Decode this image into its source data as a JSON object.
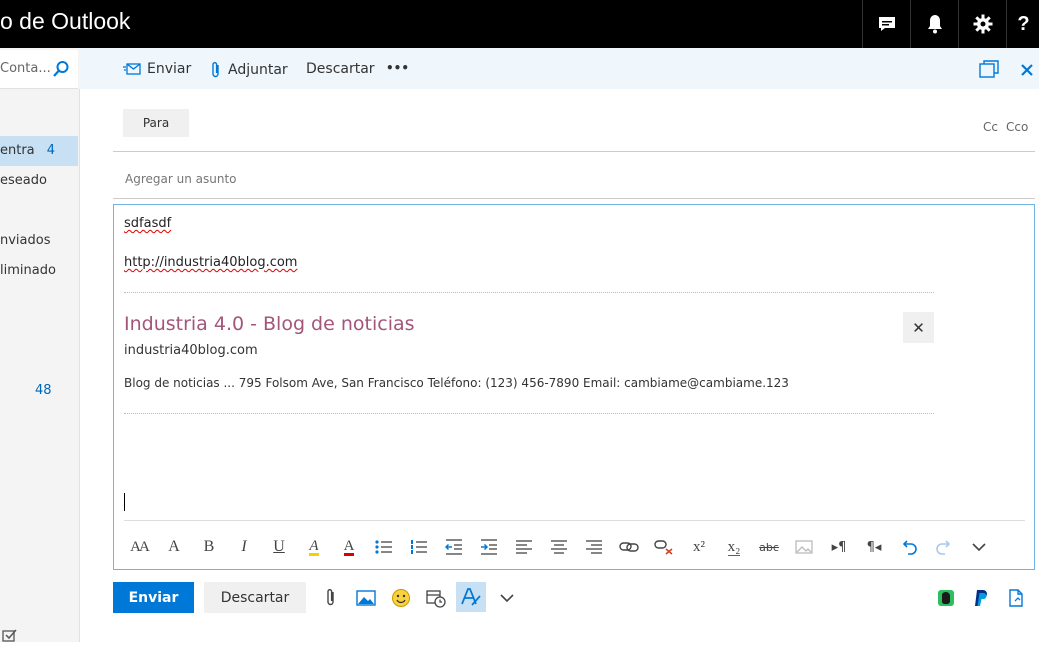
{
  "window": {
    "title": "o de Outlook"
  },
  "search": {
    "placeholder": "Conta..."
  },
  "nav": {
    "items": [
      {
        "label": "entra",
        "count": "4"
      },
      {
        "label": "eseado"
      },
      {
        "label": "nviados"
      },
      {
        "label": "liminado"
      }
    ],
    "extra_count": "48"
  },
  "toolbar": {
    "send": "Enviar",
    "attach": "Adjuntar",
    "discard": "Descartar",
    "more": "•••"
  },
  "recipients": {
    "to_label": "Para",
    "cc": "Cc",
    "bcc": "Cco"
  },
  "subject": {
    "placeholder": "Agregar un asunto"
  },
  "body": {
    "text": "sdfasdf",
    "link": "http://industria40blog.com"
  },
  "link_preview": {
    "title": "Industria 4.0 - Blog de noticias",
    "domain": "industria40blog.com",
    "description": "Blog de noticias ... 795 Folsom Ave, San Francisco Teléfono: (123) 456-7890 Email: cambiame@cambiame.123"
  },
  "format_bar": {
    "font_size": "AA",
    "grow": "A",
    "bold": "B",
    "italic": "I",
    "underline": "U",
    "highlight": "A",
    "font_color": "A",
    "strike": "abc",
    "superscript": "x²",
    "subscript": "x₂",
    "ltr": "▸¶",
    "rtl": "¶◂"
  },
  "footer": {
    "send": "Enviar",
    "discard": "Descartar"
  },
  "colors": {
    "accent": "#0078d7",
    "preview_title": "#a3567a",
    "selected_nav": "#c7e0f4",
    "command_bar": "#eff6fc"
  }
}
